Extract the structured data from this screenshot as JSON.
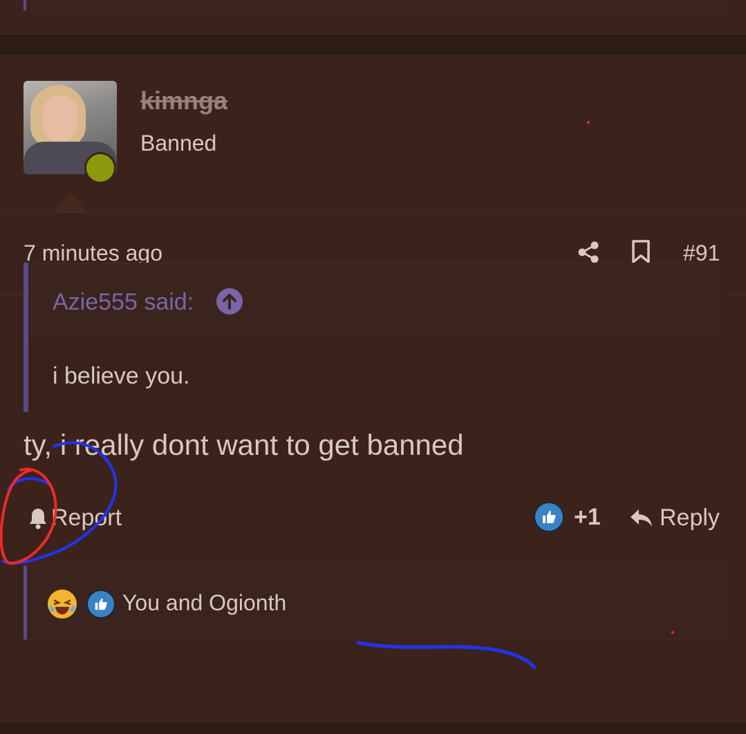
{
  "post": {
    "author": "kimnga",
    "author_title": "Banned",
    "time": "7 minutes ago",
    "post_number": "#91",
    "quote": {
      "author": "Azie555 said:",
      "text": "i believe you."
    },
    "body": "ty, i really dont want to get banned",
    "actions": {
      "report_label": "Report",
      "like_count": "+1",
      "reply_label": "Reply"
    },
    "reactions": {
      "text": "You and Ogionth"
    }
  },
  "colors": {
    "background": "#2e1d17",
    "post_bg": "#3b231c",
    "text": "#d8c9c0",
    "quote_accent": "#5a4a8a",
    "quote_author": "#7a66a6",
    "online_dot": "#8a9a0c",
    "like_badge": "#3b82c4",
    "annotation_blue": "#2233ee",
    "annotation_red": "#ee2a2a"
  },
  "icons": {
    "share": "share-icon",
    "bookmark": "bookmark-icon",
    "quote_jump": "arrow-up-circle-icon",
    "report": "bell-icon",
    "like": "thumbs-up-icon",
    "reply": "reply-arrow-icon",
    "laugh": "laughing-crying-emoji-icon"
  }
}
